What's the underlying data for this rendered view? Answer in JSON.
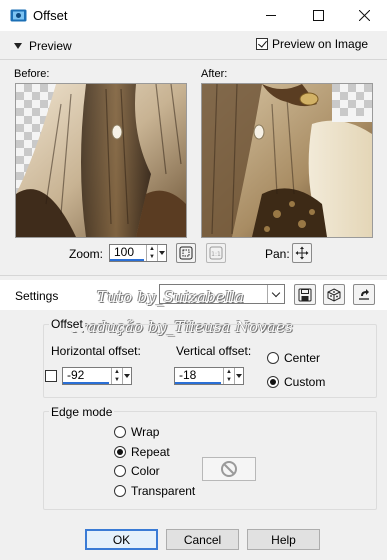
{
  "window": {
    "title": "Offset"
  },
  "preview": {
    "toggle_label": "Preview",
    "preview_on_image_label": "Preview on Image",
    "preview_on_image_checked": true,
    "before_label": "Before:",
    "after_label": "After:"
  },
  "zoom": {
    "label": "Zoom:",
    "value": "100",
    "pan_label": "Pan:"
  },
  "settings": {
    "label": "Settings",
    "preset_value": ""
  },
  "watermark": {
    "line1": "Tuto by_Suizabella",
    "line2": "Tradução by_Tileusa Novaes"
  },
  "offset": {
    "group_title": "Offset",
    "horizontal_label": "Horizontal offset:",
    "horizontal_value": "-92",
    "vertical_label": "Vertical offset:",
    "vertical_value": "-18",
    "mode_options": [
      "Center",
      "Custom"
    ],
    "mode_selected": "Custom"
  },
  "edge_mode": {
    "group_title": "Edge mode",
    "options": [
      "Wrap",
      "Repeat",
      "Color",
      "Transparent"
    ],
    "selected": "Repeat"
  },
  "buttons": {
    "ok": "OK",
    "cancel": "Cancel",
    "help": "Help"
  },
  "colors": {
    "accent": "#2a6fd6",
    "dialog_bg": "#f0f0f0"
  }
}
